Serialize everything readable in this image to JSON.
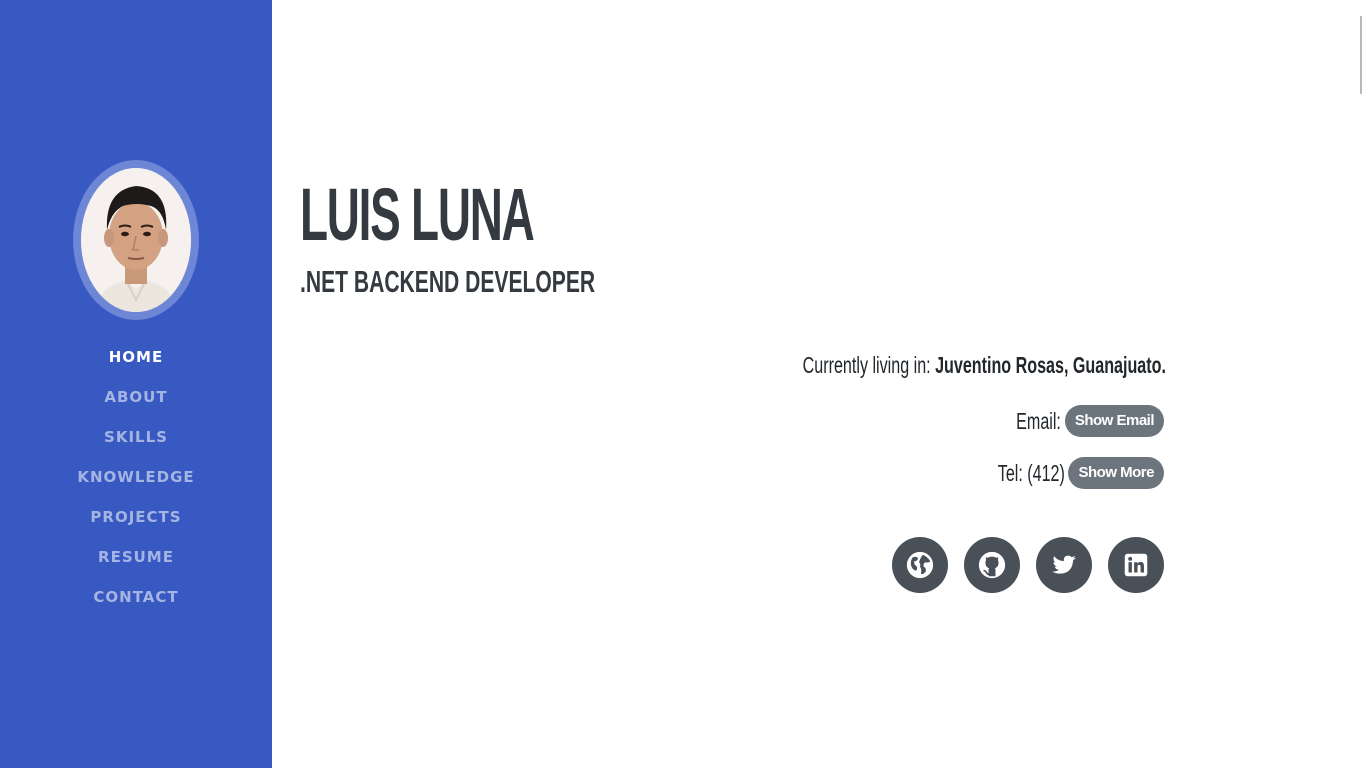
{
  "sidebar": {
    "avatar_alt": "Profile photo",
    "nav": [
      {
        "label": "HOME",
        "active": true
      },
      {
        "label": "ABOUT",
        "active": false
      },
      {
        "label": "SKILLS",
        "active": false
      },
      {
        "label": "KNOWLEDGE",
        "active": false
      },
      {
        "label": "PROJECTS",
        "active": false
      },
      {
        "label": "RESUME",
        "active": false
      },
      {
        "label": "CONTACT",
        "active": false
      }
    ]
  },
  "hero": {
    "name": "LUIS LUNA",
    "subtitle": ".NET BACKEND DEVELOPER"
  },
  "info": {
    "location_label": "Currently living in:",
    "location_value": "Juventino Rosas, Guanajuato.",
    "email_label": "Email:",
    "email_button": "Show Email",
    "tel_label": "Tel: (412)",
    "tel_button": "Show More"
  },
  "social": [
    {
      "icon": "globe-icon"
    },
    {
      "icon": "github-icon"
    },
    {
      "icon": "twitter-icon"
    },
    {
      "icon": "linkedin-icon"
    }
  ],
  "colors": {
    "sidebar": "#3759c1",
    "text_dark": "#343a40",
    "pill": "#6c757d",
    "social_bg": "#495057"
  }
}
